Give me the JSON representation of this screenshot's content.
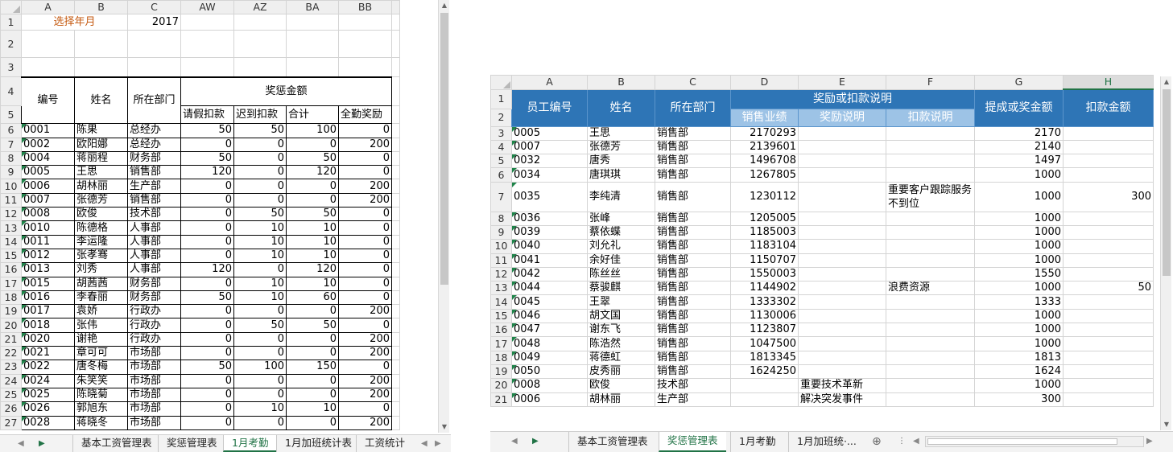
{
  "left_sheet": {
    "columns": [
      "A",
      "B",
      "C",
      "AW",
      "AZ",
      "BA",
      "BB"
    ],
    "select_label": "选择年月",
    "year": "2017",
    "title_merge": "奖惩金额",
    "headers": {
      "id": "编号",
      "name": "姓名",
      "dept": "所在部门",
      "leave": "请假扣款",
      "late": "迟到扣款",
      "total": "合计",
      "full": "全勤奖励"
    },
    "row_numbers": [
      "1",
      "2",
      "3",
      "4",
      "5",
      "6",
      "7",
      "8",
      "9",
      "10",
      "11",
      "12",
      "13",
      "14",
      "15",
      "16",
      "17",
      "18",
      "19",
      "20",
      "21",
      "22",
      "23",
      "24",
      "25",
      "26",
      "27"
    ],
    "rows": [
      [
        "0001",
        "陈果",
        "总经办",
        "50",
        "50",
        "100",
        "0"
      ],
      [
        "0002",
        "欧阳娜",
        "总经办",
        "0",
        "0",
        "0",
        "200"
      ],
      [
        "0004",
        "蒋丽程",
        "财务部",
        "50",
        "0",
        "50",
        "0"
      ],
      [
        "0005",
        "王思",
        "销售部",
        "120",
        "0",
        "120",
        "0"
      ],
      [
        "0006",
        "胡林丽",
        "生产部",
        "0",
        "0",
        "0",
        "200"
      ],
      [
        "0007",
        "张德芳",
        "销售部",
        "0",
        "0",
        "0",
        "200"
      ],
      [
        "0008",
        "欧俊",
        "技术部",
        "0",
        "50",
        "50",
        "0"
      ],
      [
        "0010",
        "陈德格",
        "人事部",
        "0",
        "10",
        "10",
        "0"
      ],
      [
        "0011",
        "李运隆",
        "人事部",
        "0",
        "10",
        "10",
        "0"
      ],
      [
        "0012",
        "张孝骞",
        "人事部",
        "0",
        "10",
        "10",
        "0"
      ],
      [
        "0013",
        "刘秀",
        "人事部",
        "120",
        "0",
        "120",
        "0"
      ],
      [
        "0015",
        "胡茜茜",
        "财务部",
        "0",
        "10",
        "10",
        "0"
      ],
      [
        "0016",
        "李春丽",
        "财务部",
        "50",
        "10",
        "60",
        "0"
      ],
      [
        "0017",
        "袁娇",
        "行政办",
        "0",
        "0",
        "0",
        "200"
      ],
      [
        "0018",
        "张伟",
        "行政办",
        "0",
        "50",
        "50",
        "0"
      ],
      [
        "0020",
        "谢艳",
        "行政办",
        "0",
        "0",
        "0",
        "200"
      ],
      [
        "0021",
        "章可可",
        "市场部",
        "0",
        "0",
        "0",
        "200"
      ],
      [
        "0022",
        "唐冬梅",
        "市场部",
        "50",
        "100",
        "150",
        "0"
      ],
      [
        "0024",
        "朱笑笑",
        "市场部",
        "0",
        "0",
        "0",
        "200"
      ],
      [
        "0025",
        "陈晓菊",
        "市场部",
        "0",
        "0",
        "0",
        "200"
      ],
      [
        "0026",
        "郭旭东",
        "市场部",
        "0",
        "10",
        "10",
        "0"
      ],
      [
        "0028",
        "蒋晓冬",
        "市场部",
        "0",
        "0",
        "0",
        "200"
      ]
    ],
    "tabs": [
      "基本工资管理表",
      "奖惩管理表",
      "1月考勤",
      "1月加班统计表",
      "工资统计"
    ],
    "active_tab": "1月考勤"
  },
  "right_sheet": {
    "columns": [
      "A",
      "B",
      "C",
      "D",
      "E",
      "F",
      "G",
      "H"
    ],
    "headers": {
      "id": "员工编号",
      "name": "姓名",
      "dept": "所在部门",
      "merge": "奖励或扣款说明",
      "sales": "销售业绩",
      "reward": "奖励说明",
      "deduct": "扣款说明",
      "bonus": "提成或奖金额",
      "deduct_amt": "扣款金额"
    },
    "row_numbers": [
      "1",
      "2",
      "3",
      "4",
      "5",
      "6",
      "7",
      "8",
      "9",
      "10",
      "11",
      "12",
      "13",
      "14",
      "15",
      "16",
      "17",
      "18",
      "19",
      "20",
      "21"
    ],
    "rows": [
      [
        "0005",
        "王思",
        "销售部",
        "2170293",
        "",
        "",
        "2170",
        ""
      ],
      [
        "0007",
        "张德芳",
        "销售部",
        "2139601",
        "",
        "",
        "2140",
        ""
      ],
      [
        "0032",
        "唐秀",
        "销售部",
        "1496708",
        "",
        "",
        "1497",
        ""
      ],
      [
        "0034",
        "唐琪琪",
        "销售部",
        "1267805",
        "",
        "",
        "1000",
        ""
      ],
      [
        "0035",
        "李纯清",
        "销售部",
        "1230112",
        "",
        "重要客户跟踪服务不到位",
        "1000",
        "300"
      ],
      [
        "0036",
        "张峰",
        "销售部",
        "1205005",
        "",
        "",
        "1000",
        ""
      ],
      [
        "0039",
        "蔡依蝶",
        "销售部",
        "1185003",
        "",
        "",
        "1000",
        ""
      ],
      [
        "0040",
        "刘允礼",
        "销售部",
        "1183104",
        "",
        "",
        "1000",
        ""
      ],
      [
        "0041",
        "余好佳",
        "销售部",
        "1150707",
        "",
        "",
        "1000",
        ""
      ],
      [
        "0042",
        "陈丝丝",
        "销售部",
        "1550003",
        "",
        "",
        "1550",
        ""
      ],
      [
        "0044",
        "蔡骏麒",
        "销售部",
        "1144902",
        "",
        "浪费资源",
        "1000",
        "50"
      ],
      [
        "0045",
        "王翠",
        "销售部",
        "1333302",
        "",
        "",
        "1333",
        ""
      ],
      [
        "0046",
        "胡文国",
        "销售部",
        "1130006",
        "",
        "",
        "1000",
        ""
      ],
      [
        "0047",
        "谢东飞",
        "销售部",
        "1123807",
        "",
        "",
        "1000",
        ""
      ],
      [
        "0048",
        "陈浩然",
        "销售部",
        "1047500",
        "",
        "",
        "1000",
        ""
      ],
      [
        "0049",
        "蒋德虹",
        "销售部",
        "1813345",
        "",
        "",
        "1813",
        ""
      ],
      [
        "0050",
        "皮秀丽",
        "销售部",
        "1624250",
        "",
        "",
        "1624",
        ""
      ],
      [
        "0008",
        "欧俊",
        "技术部",
        "",
        "重要技术革新",
        "",
        "1000",
        ""
      ],
      [
        "0006",
        "胡林丽",
        "生产部",
        "",
        "解决突发事件",
        "",
        "300",
        ""
      ]
    ],
    "tabs": [
      "基本工资管理表",
      "奖惩管理表",
      "1月考勤",
      "1月加班统·..."
    ],
    "active_tab": "奖惩管理表"
  }
}
